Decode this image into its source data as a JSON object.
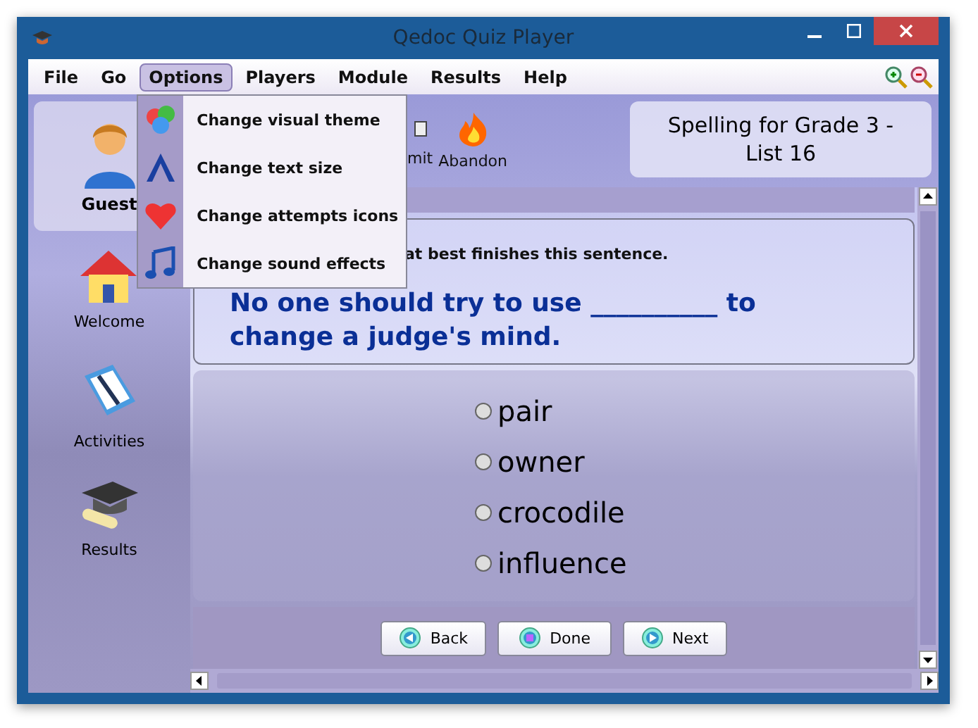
{
  "window": {
    "title": "Qedoc Quiz Player"
  },
  "menu": [
    {
      "label": "File",
      "selected": false
    },
    {
      "label": "Go",
      "selected": false
    },
    {
      "label": "Options",
      "selected": true
    },
    {
      "label": "Players",
      "selected": false
    },
    {
      "label": "Module",
      "selected": false
    },
    {
      "label": "Results",
      "selected": false
    },
    {
      "label": "Help",
      "selected": false
    }
  ],
  "options_menu": [
    {
      "label": "Change visual theme",
      "kind": "theme"
    },
    {
      "label": "Change text size",
      "kind": "text"
    },
    {
      "label": "Change attempts icons",
      "kind": "heart"
    },
    {
      "label": "Change sound effects",
      "kind": "sound"
    }
  ],
  "player": {
    "name": "Guest"
  },
  "sidebar": {
    "items": [
      {
        "label": "Welcome",
        "kind": "house"
      },
      {
        "label": "Activities",
        "kind": "book"
      },
      {
        "label": "Results",
        "kind": "cap"
      }
    ]
  },
  "toolbar": [
    {
      "label": "mit",
      "kind": "flag"
    },
    {
      "label": "Abandon",
      "kind": "fire"
    }
  ],
  "module_title": "Spelling for Grade 3 - List 16",
  "question": {
    "prompt": "at best finishes this sentence.",
    "before": "No one should try to use",
    "blank": "__________",
    "after": "to change a judge's mind.",
    "options": [
      {
        "label": "pair",
        "selected": false
      },
      {
        "label": "owner",
        "selected": false
      },
      {
        "label": "crocodile",
        "selected": false
      },
      {
        "label": "influence",
        "selected": false
      }
    ]
  },
  "buttons": [
    {
      "label": "Back",
      "kind": "back"
    },
    {
      "label": "Done",
      "kind": "done"
    },
    {
      "label": "Next",
      "kind": "next"
    }
  ]
}
